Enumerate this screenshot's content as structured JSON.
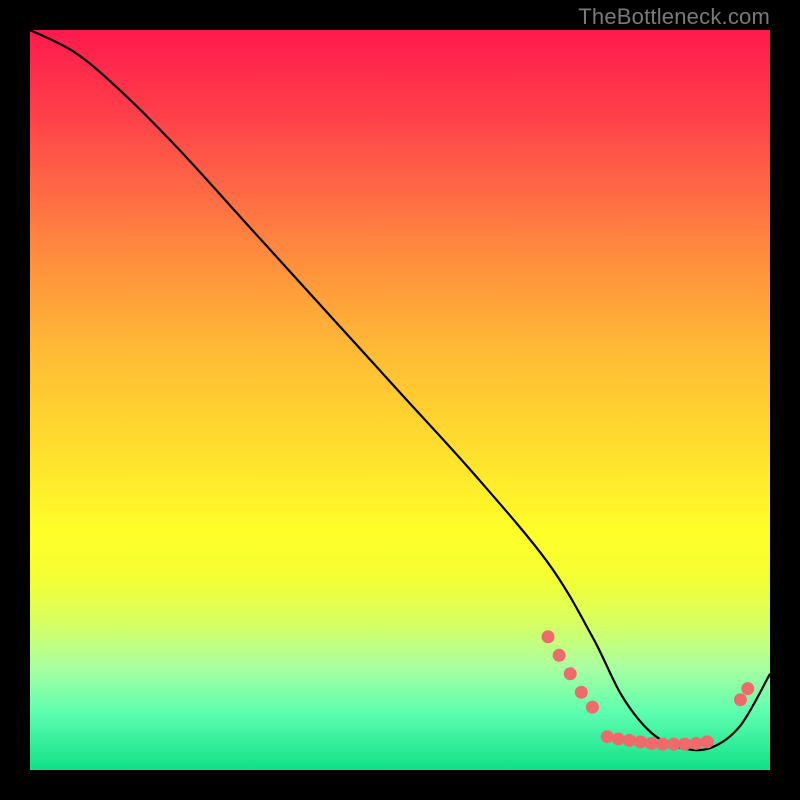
{
  "watermark": "TheBottleneck.com",
  "chart_data": {
    "type": "line",
    "title": "",
    "xlabel": "",
    "ylabel": "",
    "xlim": [
      0,
      100
    ],
    "ylim": [
      0,
      100
    ],
    "series": [
      {
        "name": "curve",
        "x": [
          0,
          6,
          12,
          20,
          30,
          40,
          50,
          60,
          70,
          76,
          80,
          84,
          88,
          92,
          96,
          100
        ],
        "y": [
          100,
          97,
          92,
          84,
          73,
          62,
          51,
          40,
          28,
          18,
          10,
          5,
          3,
          3,
          6,
          13
        ]
      }
    ],
    "markers": [
      {
        "x": 70.0,
        "y": 18.0
      },
      {
        "x": 71.5,
        "y": 15.5
      },
      {
        "x": 73.0,
        "y": 13.0
      },
      {
        "x": 74.5,
        "y": 10.5
      },
      {
        "x": 76.0,
        "y": 8.5
      },
      {
        "x": 78.0,
        "y": 4.5
      },
      {
        "x": 79.5,
        "y": 4.2
      },
      {
        "x": 81.0,
        "y": 4.0
      },
      {
        "x": 82.5,
        "y": 3.8
      },
      {
        "x": 84.0,
        "y": 3.6
      },
      {
        "x": 85.5,
        "y": 3.5
      },
      {
        "x": 87.0,
        "y": 3.5
      },
      {
        "x": 88.5,
        "y": 3.5
      },
      {
        "x": 90.0,
        "y": 3.6
      },
      {
        "x": 91.5,
        "y": 3.8
      },
      {
        "x": 96.0,
        "y": 9.5
      },
      {
        "x": 97.0,
        "y": 11.0
      }
    ],
    "marker_color": "#ef6a6a",
    "curve_color": "#000000"
  }
}
